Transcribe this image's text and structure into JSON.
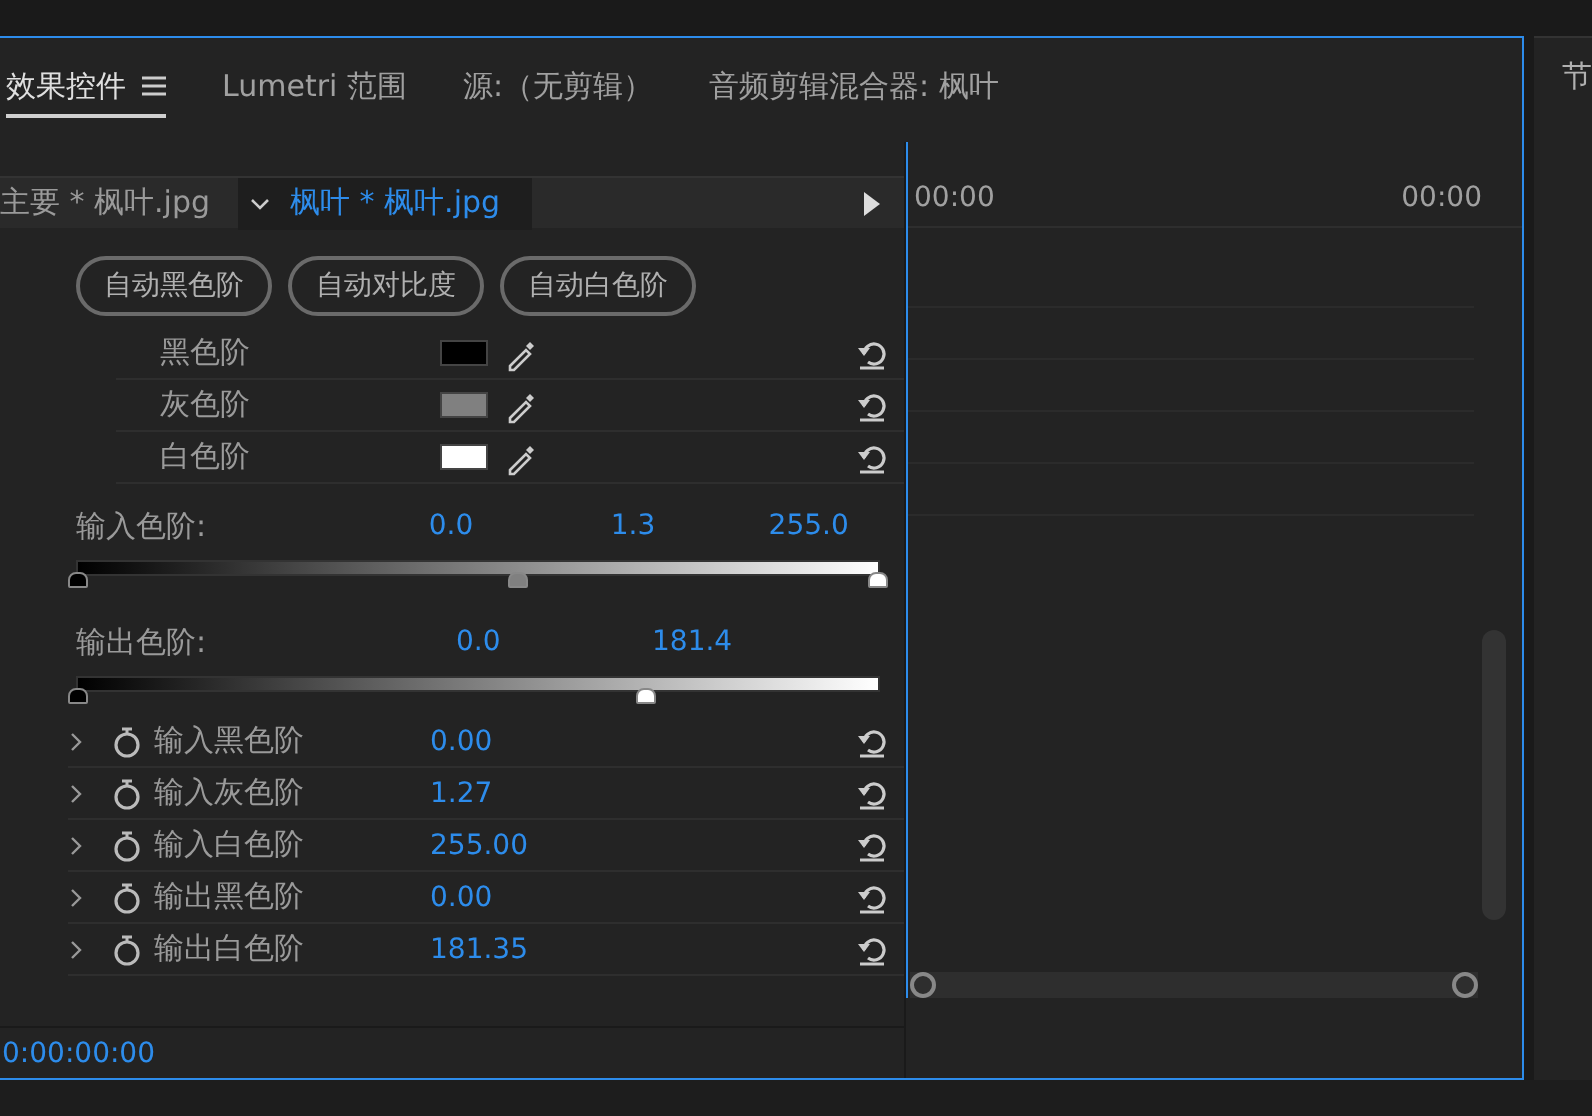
{
  "tabs": [
    {
      "label": "效果控件",
      "selected": true
    },
    {
      "label": "Lumetri 范围",
      "selected": false
    },
    {
      "label": "源:（无剪辑）",
      "selected": false
    },
    {
      "label": "音频剪辑混合器: 枫叶",
      "selected": false
    }
  ],
  "right_panel": {
    "tab": "节"
  },
  "clip_header": {
    "master": "主要 * 枫叶.jpg",
    "sequence_clip": "枫叶 * 枫叶.jpg"
  },
  "auto_buttons": [
    "自动黑色阶",
    "自动对比度",
    "自动白色阶"
  ],
  "swatches": [
    {
      "label": "黑色阶",
      "color": "#000000"
    },
    {
      "label": "灰色阶",
      "color": "#808080"
    },
    {
      "label": "白色阶",
      "color": "#ffffff"
    }
  ],
  "input_levels": {
    "label": "输入色阶:",
    "values": [
      "0.0",
      "1.3",
      "255.0"
    ],
    "handles": [
      {
        "level": 0,
        "color": "#000000"
      },
      {
        "level": 0.55,
        "color": "#808080"
      },
      {
        "level": 1,
        "color": "#ffffff"
      }
    ]
  },
  "output_levels": {
    "label": "输出色阶:",
    "values": [
      "0.0",
      "181.4"
    ],
    "handles": [
      {
        "level": 0,
        "color": "#000000"
      },
      {
        "level": 0.71,
        "color": "#ffffff"
      }
    ]
  },
  "params": [
    {
      "label": "输入黑色阶",
      "value": "0.00"
    },
    {
      "label": "输入灰色阶",
      "value": "1.27"
    },
    {
      "label": "输入白色阶",
      "value": "255.00"
    },
    {
      "label": "输出黑色阶",
      "value": "0.00"
    },
    {
      "label": "输出白色阶",
      "value": "181.35"
    }
  ],
  "timeline": {
    "start": "00:00",
    "end": "00:00"
  },
  "timecode": "0:00:00:00"
}
